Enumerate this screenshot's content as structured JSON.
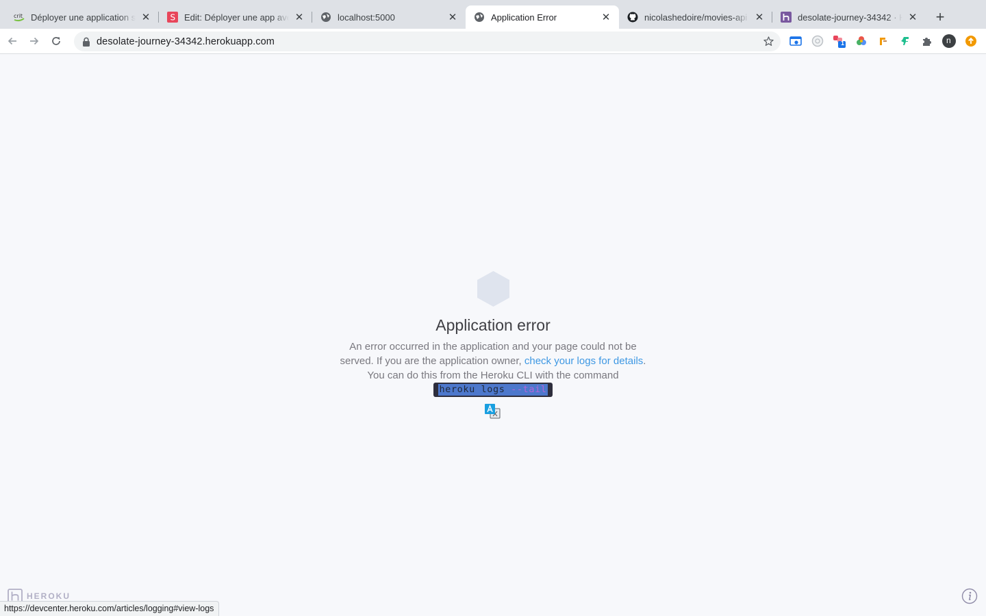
{
  "browser": {
    "tabs": [
      {
        "title": "Déployer une application sur",
        "favicon": "crit-logo-icon"
      },
      {
        "title": "Edit: Déployer une app avec",
        "favicon": "s-logo-icon"
      },
      {
        "title": "localhost:5000",
        "favicon": "globe-icon"
      },
      {
        "title": "Application Error",
        "favicon": "globe-icon",
        "active": true
      },
      {
        "title": "nicolashedoire/movies-api",
        "favicon": "github-icon"
      },
      {
        "title": "desolate-journey-34342 · H",
        "favicon": "heroku-icon"
      }
    ],
    "new_tab_label": "+",
    "address": "desolate-journey-34342.herokuapp.com",
    "profile_initial": "n",
    "extension_badge": "1",
    "crit_logo_text": "crit"
  },
  "page": {
    "title": "Application error",
    "body_part1": "An error occurred in the application and your page could not be served. If you are the application owner, ",
    "link_text": "check your logs for details",
    "body_part2": ". You can do this from the Heroku CLI with the command",
    "command_main": "heroku logs ",
    "command_flag": "--tail",
    "footer_brand": "HEROKU",
    "status_url": "https://devcenter.heroku.com/articles/logging#view-logs"
  },
  "colors": {
    "background": "#f7f8fb",
    "link": "#3e98e3",
    "hexagon": "#dfe4ee"
  }
}
